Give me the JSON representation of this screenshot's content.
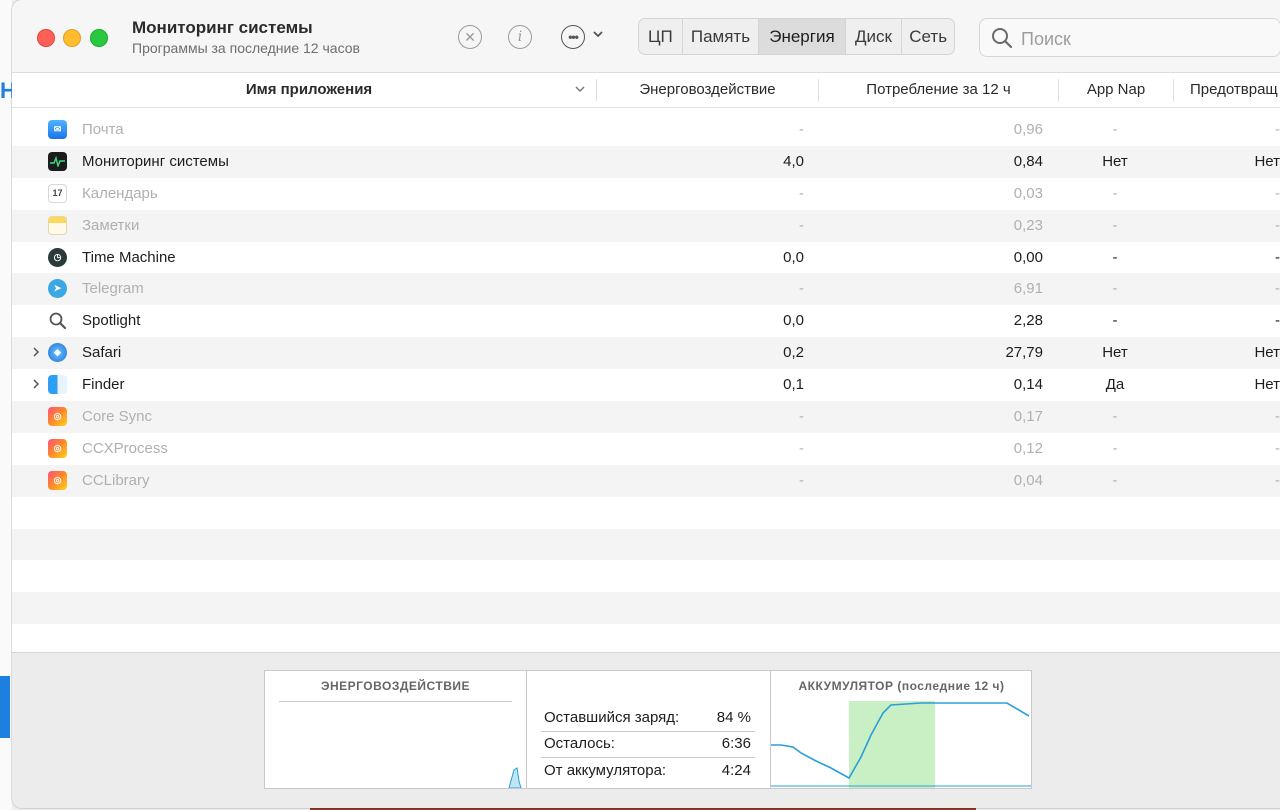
{
  "window": {
    "title": "Мониторинг системы",
    "subtitle": "Программы за последние 12 часов"
  },
  "toolbar": {
    "stop_icon": "x-circle-icon",
    "info_icon": "info-icon",
    "more_icon": "ellipsis-icon",
    "tabs": [
      {
        "label": "ЦП",
        "active": false
      },
      {
        "label": "Память",
        "active": false
      },
      {
        "label": "Энергия",
        "active": true
      },
      {
        "label": "Диск",
        "active": false
      },
      {
        "label": "Сеть",
        "active": false
      }
    ],
    "search_placeholder": "Поиск"
  },
  "table": {
    "columns": {
      "name": "Имя приложения",
      "impact": "Энерговоздействие",
      "consumption": "Потребление за 12 ч",
      "appnap": "App Nap",
      "prevent": "Предотвращ"
    },
    "rows": [
      {
        "name": "Почта",
        "icon": "mail-icon",
        "impact": "-",
        "consumption": "0,96",
        "appnap": "-",
        "prevent": "-",
        "dim": true,
        "expandable": false
      },
      {
        "name": "Мониторинг системы",
        "icon": "activity-monitor-icon",
        "impact": "4,0",
        "consumption": "0,84",
        "appnap": "Нет",
        "prevent": "Нет",
        "dim": false,
        "expandable": false
      },
      {
        "name": "Календарь",
        "icon": "calendar-icon",
        "impact": "-",
        "consumption": "0,03",
        "appnap": "-",
        "prevent": "-",
        "dim": true,
        "expandable": false
      },
      {
        "name": "Заметки",
        "icon": "notes-icon",
        "impact": "-",
        "consumption": "0,23",
        "appnap": "-",
        "prevent": "-",
        "dim": true,
        "expandable": false
      },
      {
        "name": "Time Machine",
        "icon": "time-machine-icon",
        "impact": "0,0",
        "consumption": "0,00",
        "appnap": "-",
        "prevent": "-",
        "dim": false,
        "expandable": false
      },
      {
        "name": "Telegram",
        "icon": "telegram-icon",
        "impact": "-",
        "consumption": "6,91",
        "appnap": "-",
        "prevent": "-",
        "dim": true,
        "expandable": false
      },
      {
        "name": "Spotlight",
        "icon": "spotlight-icon",
        "impact": "0,0",
        "consumption": "2,28",
        "appnap": "-",
        "prevent": "-",
        "dim": false,
        "expandable": false
      },
      {
        "name": "Safari",
        "icon": "safari-icon",
        "impact": "0,2",
        "consumption": "27,79",
        "appnap": "Нет",
        "prevent": "Нет",
        "dim": false,
        "expandable": true
      },
      {
        "name": "Finder",
        "icon": "finder-icon",
        "impact": "0,1",
        "consumption": "0,14",
        "appnap": "Да",
        "prevent": "Нет",
        "dim": false,
        "expandable": true
      },
      {
        "name": "Core Sync",
        "icon": "creative-cloud-icon",
        "impact": "-",
        "consumption": "0,17",
        "appnap": "-",
        "prevent": "-",
        "dim": true,
        "expandable": false
      },
      {
        "name": "CCXProcess",
        "icon": "creative-cloud-icon",
        "impact": "-",
        "consumption": "0,12",
        "appnap": "-",
        "prevent": "-",
        "dim": true,
        "expandable": false
      },
      {
        "name": "CCLibrary",
        "icon": "creative-cloud-icon",
        "impact": "-",
        "consumption": "0,04",
        "appnap": "-",
        "prevent": "-",
        "dim": true,
        "expandable": false
      }
    ]
  },
  "bottom_panel": {
    "impact_title": "ЭНЕРГОВОЗДЕЙСТВИЕ",
    "battery_title": "АККУМУЛЯТОР (последние 12 ч)",
    "stats": [
      {
        "label": "Оставшийся заряд:",
        "value": "84 %"
      },
      {
        "label": "Осталось:",
        "value": "6:36"
      },
      {
        "label": "От аккумулятора:",
        "value": "4:24"
      }
    ]
  },
  "colors": {
    "chart_line": "#2a9fd8",
    "battery_charging": "#c9efc4",
    "active_tab": "#dcdcdc"
  }
}
